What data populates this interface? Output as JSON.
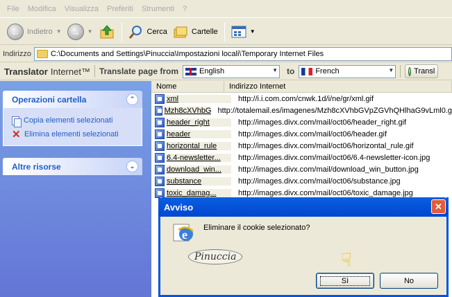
{
  "menubar": {
    "items": [
      "File",
      "Modifica",
      "Visualizza",
      "Preferiti",
      "Strumenti",
      "?"
    ]
  },
  "toolbar": {
    "back_label": "Indietro",
    "search_label": "Cerca",
    "folders_label": "Cartelle"
  },
  "addressbar": {
    "label": "Indirizzo",
    "value": "C:\\Documents and Settings\\Pinuccia\\Impostazioni locali\\Temporary Internet Files"
  },
  "translator": {
    "brand": "Translator",
    "brand2": "Internet™",
    "translate_page_label": "Translate page from",
    "from_lang": "English",
    "to_label": "to",
    "to_lang": "French",
    "translate_button": "Transl"
  },
  "taskpane": {
    "operations_title": "Operazioni cartella",
    "copy_label": "Copia elementi selezionati",
    "delete_label": "Elimina elementi selezionati",
    "other_title": "Altre risorse"
  },
  "filelist": {
    "col_name": "Nome",
    "col_address": "Indirizzo Internet",
    "rows": [
      {
        "name": "xml",
        "address": "http://i.i.com.com/cnwk.1d/i/ne/gr/xml.gif"
      },
      {
        "name": "Mzh8cXVhbGV...",
        "address": "http://totalemail.es/imagenes/Mzh8cXVhbGVpZGVhQHlhaG9vLml0.g"
      },
      {
        "name": "header_right",
        "address": "http://images.divx.com/mail/oct06/header_right.gif"
      },
      {
        "name": "header",
        "address": "http://images.divx.com/mail/oct06/header.gif"
      },
      {
        "name": "horizontal_rule",
        "address": "http://images.divx.com/mail/oct06/horizontal_rule.gif"
      },
      {
        "name": "6.4-newsletter...",
        "address": "http://images.divx.com/mail/oct06/6.4-newsletter-icon.jpg"
      },
      {
        "name": "download_win...",
        "address": "http://images.divx.com/mail/download_win_button.jpg"
      },
      {
        "name": "substance",
        "address": "http://images.divx.com/mail/oct06/substance.jpg"
      },
      {
        "name": "toxic_damag...",
        "address": "http://images.divx.com/mail/oct06/toxic_damage.jpg"
      }
    ]
  },
  "dialog": {
    "title": "Avviso",
    "message": "Eliminare il cookie selezionato?",
    "signature": "Pinuccia",
    "yes_label": "Sì",
    "no_label": "No"
  }
}
